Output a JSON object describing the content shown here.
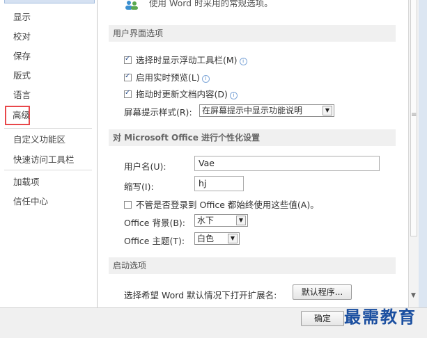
{
  "sidebar": {
    "items": [
      {
        "label": "显示"
      },
      {
        "label": "校对"
      },
      {
        "label": "保存"
      },
      {
        "label": "版式"
      },
      {
        "label": "语言"
      },
      {
        "label": "高级",
        "selected": true
      },
      {
        "label": "自定义功能区"
      },
      {
        "label": "快速访问工具栏"
      },
      {
        "label": "加载项"
      },
      {
        "label": "信任中心"
      }
    ]
  },
  "main": {
    "intro_text": "使用 Word 时采用的常规选项。",
    "ui_options": {
      "header": "用户界面选项",
      "mini_toolbar": {
        "label": "选择时显示浮动工具栏(M)",
        "checked": true
      },
      "live_preview": {
        "label": "启用实时预览(L)",
        "checked": true
      },
      "update_while_drag": {
        "label": "拖动时更新文档内容(D)",
        "checked": true
      },
      "screentip_label": "屏幕提示样式(R):",
      "screentip_value": "在屏幕提示中显示功能说明"
    },
    "personalize": {
      "header": "对 Microsoft Office 进行个性化设置",
      "username_label": "用户名(U):",
      "username_value": "Vae",
      "initials_label": "缩写(I):",
      "initials_value": "hj",
      "always_use_label": "不管是否登录到 Office 都始终使用这些值(A)。",
      "always_use_checked": false,
      "background_label": "Office 背景(B):",
      "background_value": "水下",
      "theme_label": "Office 主题(T):",
      "theme_value": "白色"
    },
    "startup": {
      "header": "启动选项",
      "extensions_label": "选择希望 Word 默认情况下打开扩展名:",
      "default_programs_button": "默认程序..."
    }
  },
  "footer": {
    "ok_button": "确定"
  },
  "watermark": "最需教育",
  "colors": {
    "selected_border": "#e8474a",
    "section_bg": "#f0f0f0",
    "watermark": "#1b4fa0"
  }
}
